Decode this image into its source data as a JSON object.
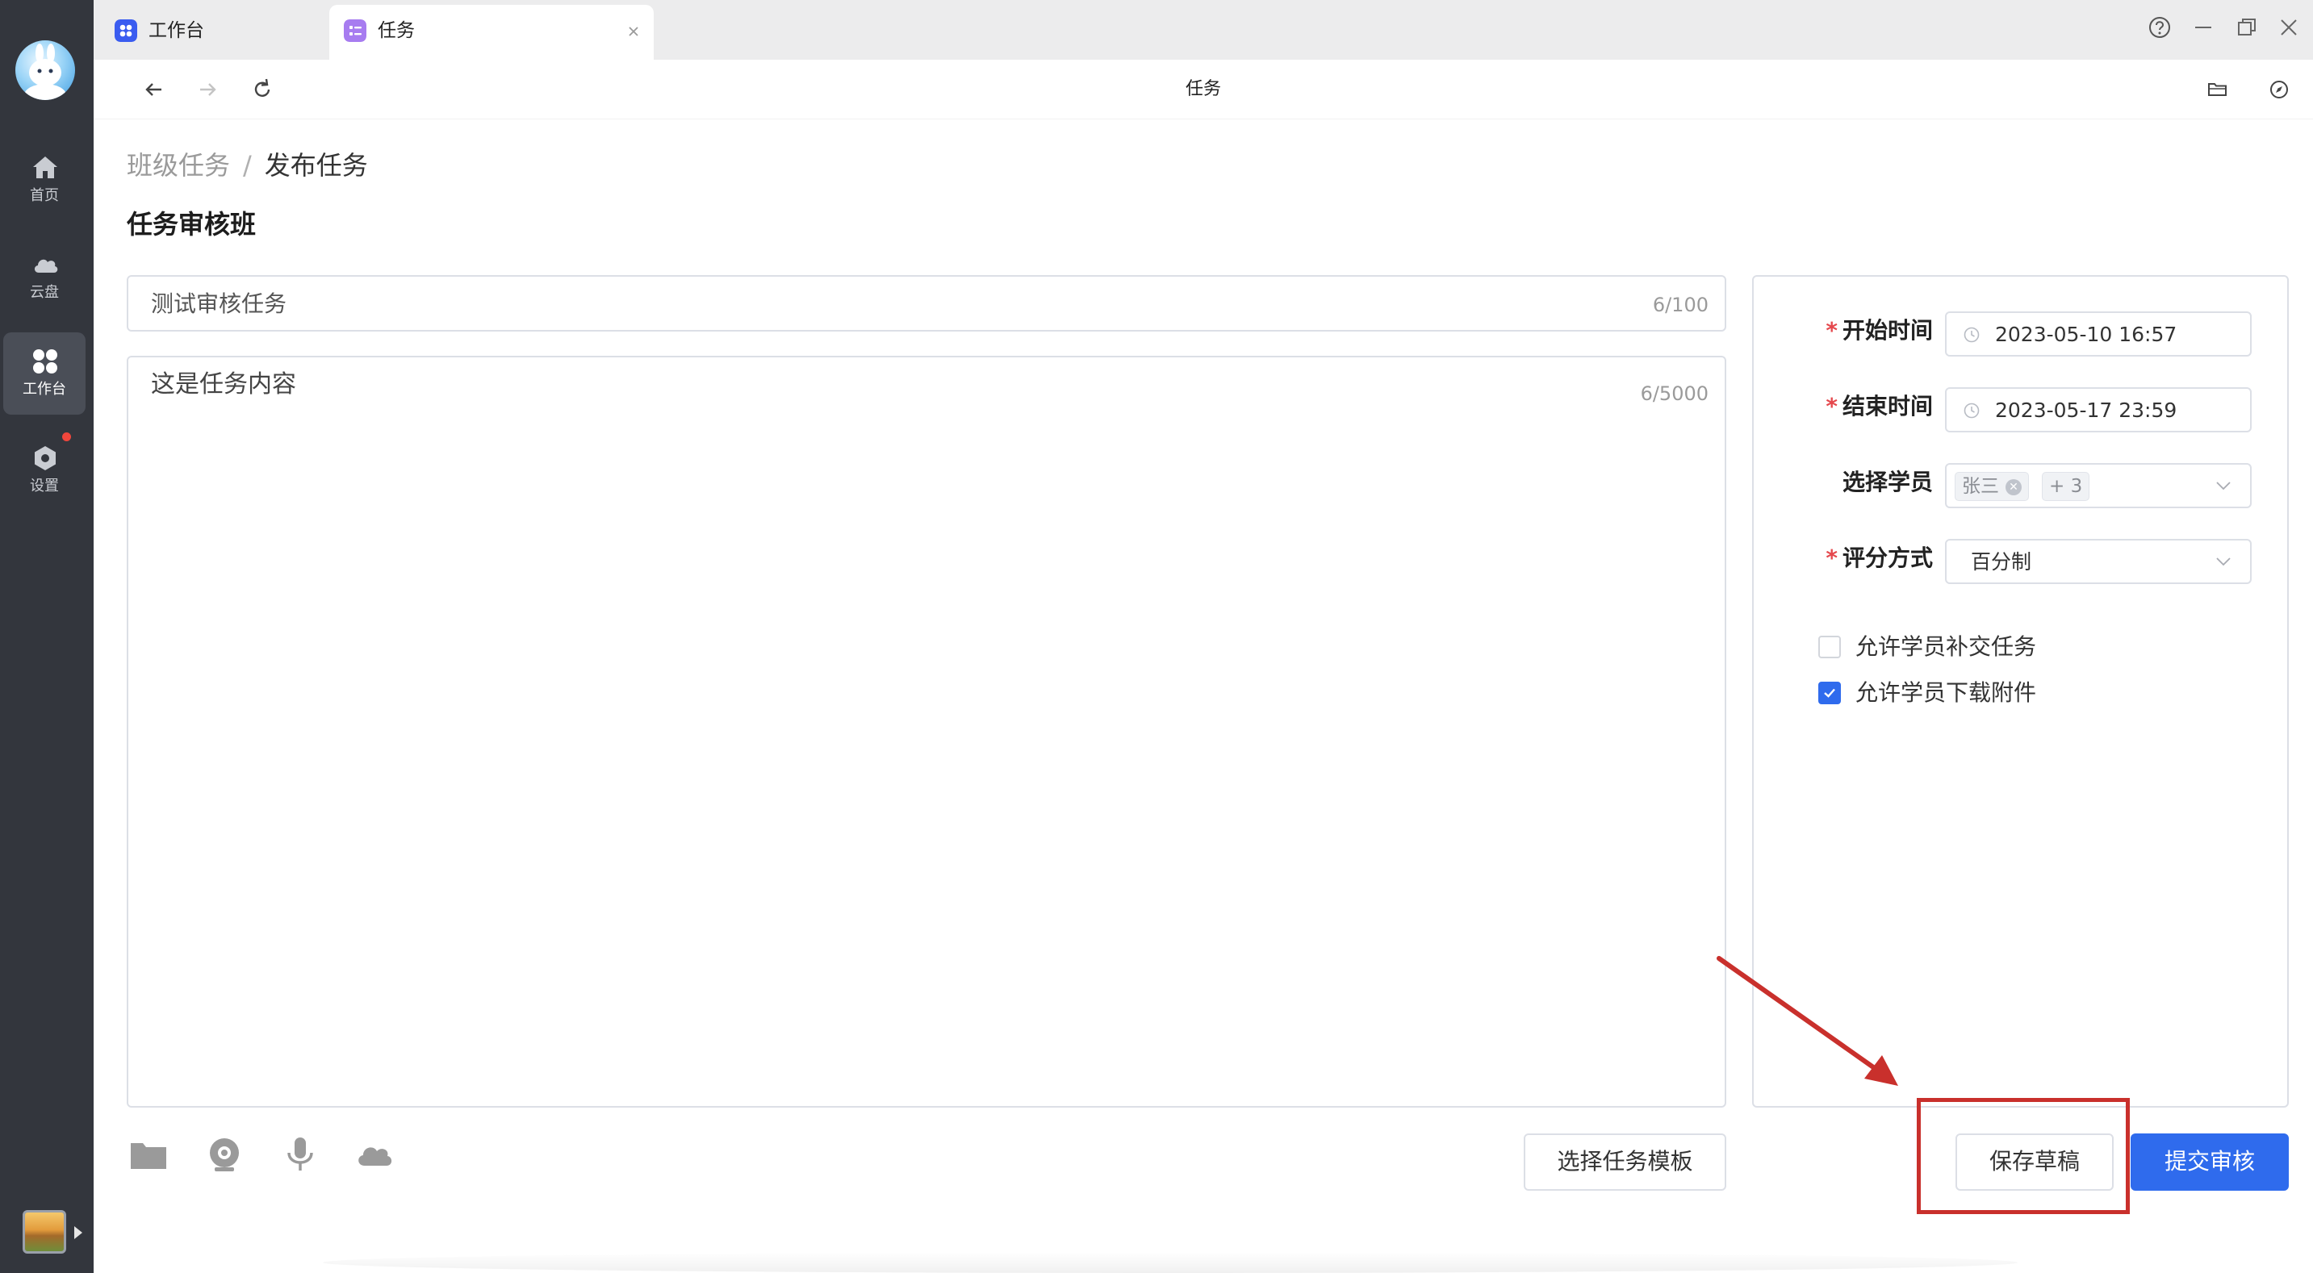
{
  "sidebar": {
    "items": [
      {
        "label": "首页",
        "icon": "home-icon"
      },
      {
        "label": "云盘",
        "icon": "cloud-icon"
      },
      {
        "label": "工作台",
        "icon": "workbench-icon",
        "active": true
      },
      {
        "label": "设置",
        "icon": "settings-icon",
        "badge": true
      }
    ]
  },
  "tabs": [
    {
      "label": "工作台",
      "icon": "workbench-tab-icon",
      "icon_color": "#3a5cf0"
    },
    {
      "label": "任务",
      "icon": "task-tab-icon",
      "icon_color": "#a77cf0",
      "active": true
    }
  ],
  "toolbar": {
    "title": "任务"
  },
  "breadcrumb": {
    "parent": "班级任务",
    "separator": "/",
    "current": "发布任务"
  },
  "class_title": "任务审核班",
  "task": {
    "title_value": "测试审核任务",
    "title_count": "6/100",
    "content_value": "这是任务内容",
    "content_count": "6/5000"
  },
  "actions": {
    "template_button": "选择任务模板",
    "save_draft_button": "保存草稿",
    "submit_button": "提交审核"
  },
  "settings": {
    "start_time_label": "开始时间",
    "start_time_value": "2023-05-10 16:57",
    "end_time_label": "结束时间",
    "end_time_value": "2023-05-17 23:59",
    "students_label": "选择学员",
    "student_tag": "张三",
    "student_more": "+ 3",
    "grading_label": "评分方式",
    "grading_value": "百分制",
    "required_mark": "*",
    "allow_late_label": "允许学员补交任务",
    "allow_late_checked": false,
    "allow_download_label": "允许学员下载附件",
    "allow_download_checked": true
  },
  "colors": {
    "primary": "#2f6bed",
    "sidebar_bg": "#33363d",
    "annotation": "#c9302c",
    "required": "#e5484d"
  }
}
